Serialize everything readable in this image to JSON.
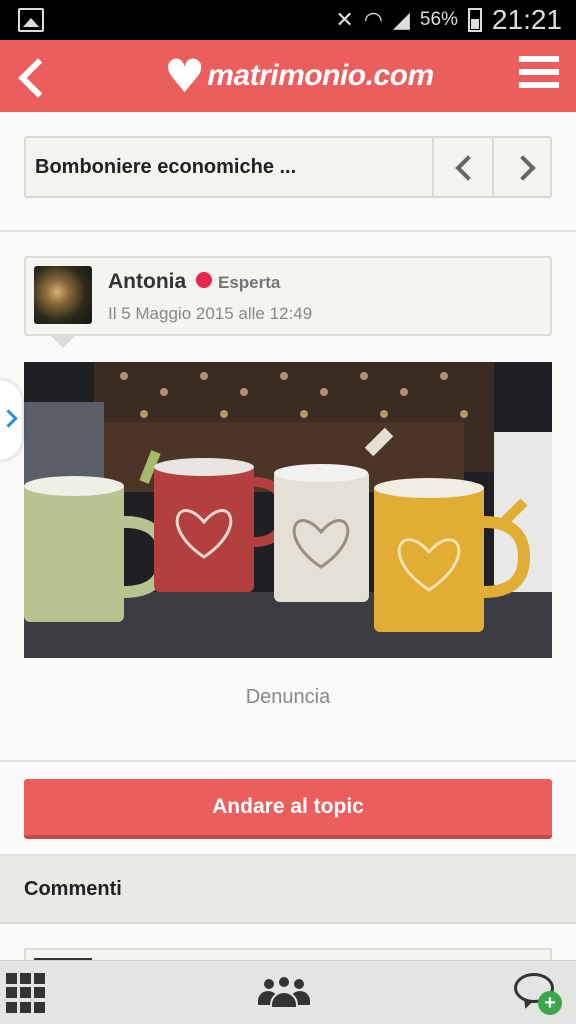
{
  "status_bar": {
    "battery_percent": "56%",
    "time": "21:21",
    "icons": [
      "image-icon",
      "mute-icon",
      "wifi-icon",
      "signal-icon",
      "battery-icon"
    ]
  },
  "header": {
    "logo_text": "matrimonio.com",
    "icons": [
      "back-icon",
      "heart-logo-icon",
      "menu-icon"
    ]
  },
  "topic_nav": {
    "title": "Bomboniere economiche ...",
    "icons": [
      "chevron-left-icon",
      "chevron-right-icon"
    ]
  },
  "post": {
    "author": "Antonia",
    "rank": "Esperta",
    "date": "Il 5 Maggio 2015 alle 12:49",
    "status_color": "#e8244a",
    "report_label": "Denuncia"
  },
  "goto_button": {
    "label": "Andare al topic"
  },
  "comments": {
    "title": "Commenti"
  },
  "bottom_bar": {
    "icons": [
      "grid-menu-icon",
      "people-icon",
      "add-comment-icon"
    ]
  },
  "colors": {
    "brand": "#ec5e5e",
    "accent_blue": "#2a8fd8",
    "add_green": "#3aa84a"
  }
}
